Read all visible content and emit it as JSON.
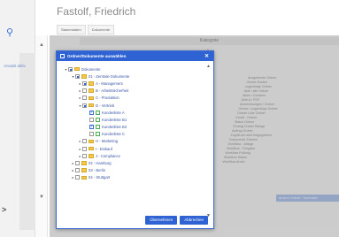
{
  "header": {
    "title": "Fastolf, Friedrich"
  },
  "top_tabs": [
    "Stammdaten",
    "Dokumente"
  ],
  "sidebar": {
    "label": "Annabt aktiv"
  },
  "background": {
    "column_header": "Kategorie",
    "rows": [
      "Ausgehende Ordner",
      "Ordner Konten",
      "zugehörige Ordner",
      "Akte / alle Ordner",
      "Akten / Dossiers",
      "Akte-A / PDF",
      "Anzeichnungen / Ordner",
      "Ordner / zugehörige Ordner",
      "Ordner Liste Ordner",
      "Kredit - Ordner",
      "Status Ordner",
      "Eintrag Ordner Belege",
      "Auftrag Ordner",
      "Zugriff auf nicht freigegebene",
      "Dokumente Zeichen",
      "Workflow - Ablage",
      "Workflow - Freigabe",
      "Workflow Prüfung",
      "Workflow Status",
      "Workflow Archiv"
    ],
    "action_button": "andere Ordner / Sachakte"
  },
  "dialog": {
    "title": "Ordner/Dokumente auswählen",
    "tree": [
      {
        "label": "Dokumente",
        "depth": 0,
        "arrow": "▾",
        "check": "partial",
        "icon": "folder"
      },
      {
        "label": "01 - Zentrale Dokumente",
        "depth": 1,
        "arrow": "▾",
        "check": "partial",
        "icon": "folder"
      },
      {
        "label": "A - Management",
        "depth": 2,
        "arrow": "▸",
        "check": "partial",
        "icon": "folder"
      },
      {
        "label": "B - Arbeitssicherheit",
        "depth": 2,
        "arrow": "▸",
        "check": "none",
        "icon": "folder"
      },
      {
        "label": "C - Produktion",
        "depth": 2,
        "arrow": "▸",
        "check": "none",
        "icon": "folder"
      },
      {
        "label": "D - Vertrieb",
        "depth": 2,
        "arrow": "▾",
        "check": "partial",
        "icon": "folder"
      },
      {
        "label": "Kundenliste A",
        "depth": 3,
        "arrow": "",
        "check": "checked",
        "icon": "doc"
      },
      {
        "label": "Kundenliste B1",
        "depth": 3,
        "arrow": "",
        "check": "none",
        "icon": "doc"
      },
      {
        "label": "Kundenliste B2",
        "depth": 3,
        "arrow": "",
        "check": "checked",
        "icon": "doc"
      },
      {
        "label": "Kundenliste C",
        "depth": 3,
        "arrow": "",
        "check": "none",
        "icon": "doc"
      },
      {
        "label": "H - Marketing",
        "depth": 2,
        "arrow": "▸",
        "check": "none",
        "icon": "folder"
      },
      {
        "label": "I - Einkauf",
        "depth": 2,
        "arrow": "▸",
        "check": "none",
        "icon": "folder"
      },
      {
        "label": "J - Compliance",
        "depth": 2,
        "arrow": "▸",
        "check": "none",
        "icon": "folder"
      },
      {
        "label": "02 - Hamburg",
        "depth": 1,
        "arrow": "▸",
        "check": "none",
        "icon": "folder"
      },
      {
        "label": "03 - Berlin",
        "depth": 1,
        "arrow": "▸",
        "check": "none",
        "icon": "folder"
      },
      {
        "label": "04 - Stuttgart",
        "depth": 1,
        "arrow": "▸",
        "check": "none",
        "icon": "folder"
      }
    ],
    "ok_label": "Übernehmen",
    "cancel_label": "Abbrechen"
  },
  "icons": {
    "search": "search-icon",
    "close": "close-icon",
    "folder": "folder-icon",
    "document": "document-icon"
  },
  "colors": {
    "accent": "#2f63d3",
    "folder": "#f2c94c",
    "doc_border": "#4caf50"
  }
}
